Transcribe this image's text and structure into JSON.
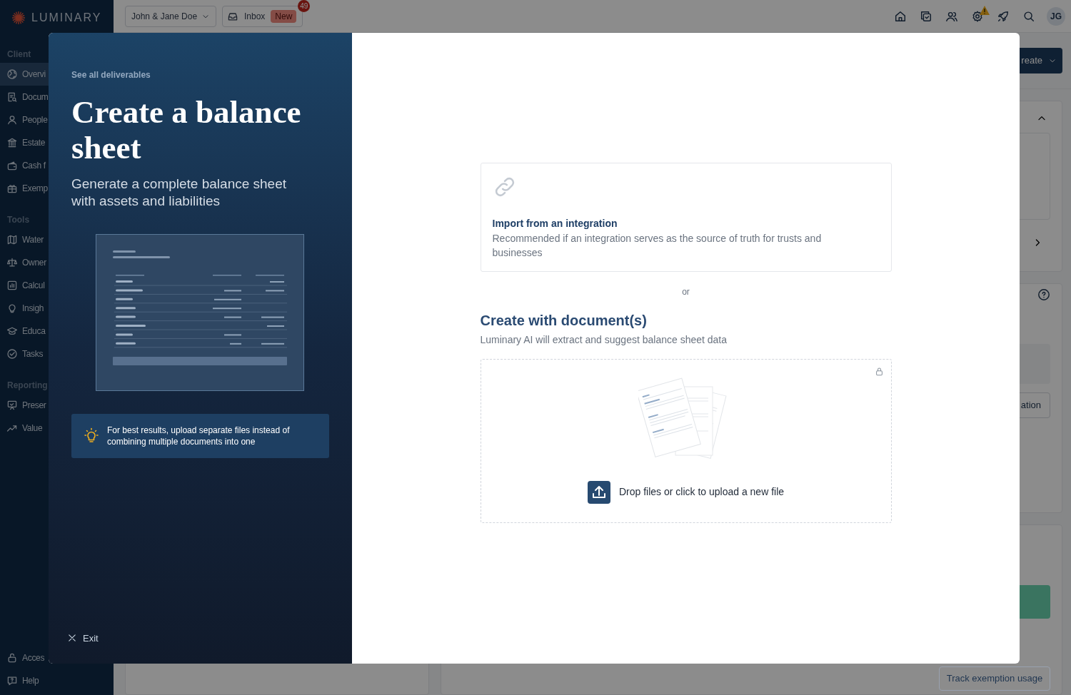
{
  "sidebar": {
    "logo": "LUMINARY",
    "sections": [
      {
        "heading": "Client",
        "items": [
          {
            "label": "Overvi",
            "selected": true
          },
          {
            "label": "Docum",
            "selected": false
          },
          {
            "label": "People",
            "selected": false
          },
          {
            "label": "Estate",
            "selected": false
          },
          {
            "label": "Cash f",
            "selected": false
          },
          {
            "label": "Exemp",
            "selected": false
          }
        ]
      },
      {
        "heading": "Tools",
        "items": [
          {
            "label": "Water",
            "selected": false
          },
          {
            "label": "Owner",
            "selected": false
          },
          {
            "label": "Calcul",
            "selected": false
          },
          {
            "label": "Insigh",
            "selected": false
          },
          {
            "label": "Educa",
            "selected": false
          },
          {
            "label": "Tasks",
            "selected": false
          }
        ]
      },
      {
        "heading": "Reporting",
        "items": [
          {
            "label": "Preser",
            "selected": false
          },
          {
            "label": "Value",
            "selected": false
          }
        ]
      }
    ],
    "footer_items": [
      {
        "label": "Acces",
        "selected": false
      },
      {
        "label": "Help",
        "selected": false
      }
    ]
  },
  "top_bar": {
    "client_selector": "John & Jane Doe",
    "inbox": {
      "label": "Inbox",
      "badge": "New",
      "count": "49"
    },
    "avatar": "JG"
  },
  "background": {
    "create_button": "reate",
    "button_2": "ation",
    "track_button": "Track exemption usage"
  },
  "modal": {
    "back_link": "See all deliverables",
    "title": "Create a balance sheet",
    "subtitle": "Generate a complete balance sheet with assets and liabilities",
    "tip": "For best results, upload separate files instead of combining multiple documents into one",
    "exit": "Exit",
    "integration": {
      "title": "Import from an integration",
      "description": "Recommended if an integration serves as the source of truth for trusts and businesses"
    },
    "separator": "or",
    "documents": {
      "title": "Create with document(s)",
      "description": "Luminary AI will extract and suggest balance sheet data"
    },
    "dropzone": {
      "label": "Drop files or click to upload a new file"
    }
  }
}
